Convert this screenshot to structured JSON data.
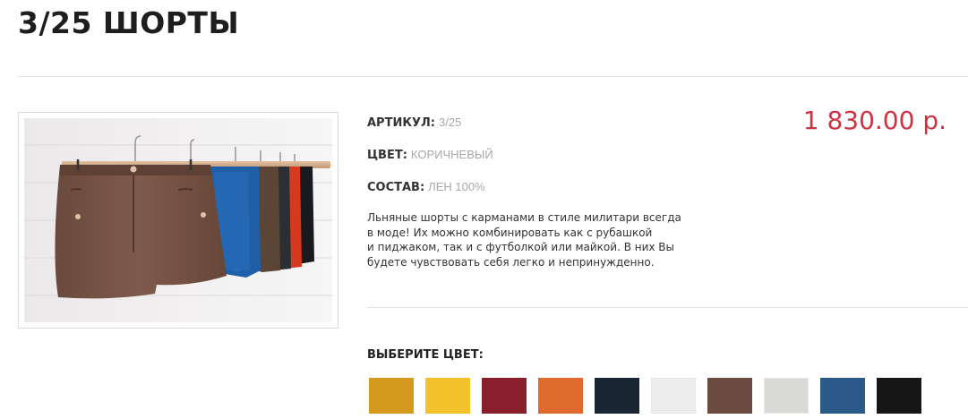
{
  "product": {
    "title": "3/25 ШОРТЫ",
    "image_alt": "shorts-on-hangers",
    "price": "1 830.00 р.",
    "specs": [
      {
        "label": "АРТИКУЛ:",
        "value": "3/25"
      },
      {
        "label": "ЦВЕТ:",
        "value": "КОРИЧНЕВЫЙ"
      },
      {
        "label": "СОСТАВ:",
        "value": "ЛЕН 100%"
      }
    ],
    "description": [
      "Льняные шорты с карманами в стиле милитари всегда",
      "в моде! Их можно комбинировать как с рубашкой",
      "и пиджаком, так и с футболкой или майкой. В них Вы",
      "будете чувствовать себя легко и непринужденно."
    ]
  },
  "color_picker": {
    "label": "ВЫБЕРИТЕ ЦВЕТ:",
    "swatches": [
      "#d39a1e",
      "#f2c22a",
      "#8a1f2d",
      "#df6a2e",
      "#1a2534",
      "#ededed",
      "#6b4a40",
      "#d9d9d6",
      "#2c5a88",
      "#161616"
    ]
  },
  "colors": {
    "accent_price": "#cf3240",
    "muted_value": "#a8a8a8"
  }
}
